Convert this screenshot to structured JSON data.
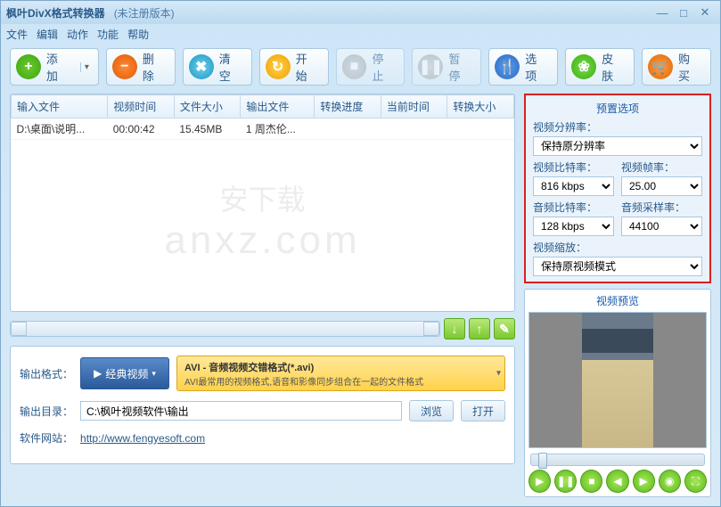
{
  "titlebar": {
    "title": "枫叶DivX格式转换器",
    "subtitle": "(未注册版本)"
  },
  "menu": {
    "file": "文件",
    "edit": "编辑",
    "action": "动作",
    "function": "功能",
    "help": "帮助"
  },
  "toolbar": {
    "add": "添加",
    "delete": "删除",
    "clear": "清空",
    "start": "开始",
    "stop": "停止",
    "pause": "暂停",
    "options": "选项",
    "skin": "皮肤",
    "buy": "购买"
  },
  "table": {
    "headers": {
      "input": "输入文件",
      "vtime": "视频时间",
      "fsize": "文件大小",
      "output": "输出文件",
      "progress": "转换进度",
      "curtime": "当前时间",
      "convsize": "转换大小"
    },
    "rows": [
      {
        "input": "D:\\桌面\\说明...",
        "vtime": "00:00:42",
        "fsize": "15.45MB",
        "output": "1 周杰伦...",
        "progress": "",
        "curtime": "",
        "convsize": ""
      }
    ]
  },
  "watermark": {
    "text1": "安下载",
    "text2": "anxz.com"
  },
  "output": {
    "format_label": "输出格式：",
    "profile_group": "经典视频",
    "profile_title": "AVI - 音频视频交错格式(*.avi)",
    "profile_desc": "AVI最常用的视频格式,语音和影像同步组合在一起的文件格式",
    "dir_label": "输出目录：",
    "dir_value": "C:\\枫叶视频软件\\输出",
    "browse": "浏览",
    "open": "打开",
    "site_label": "软件网站：",
    "site_url": "http://www.fengyesoft.com"
  },
  "preset": {
    "title": "预置选项",
    "res_label": "视频分辨率：",
    "res_value": "保持原分辨率",
    "vbr_label": "视频比特率：",
    "vbr_value": "816 kbps",
    "fps_label": "视频帧率：",
    "fps_value": "25.00",
    "abr_label": "音频比特率：",
    "abr_value": "128 kbps",
    "asr_label": "音频采样率：",
    "asr_value": "44100",
    "scale_label": "视频缩放：",
    "scale_value": "保持原视频模式"
  },
  "preview": {
    "title": "视频预览"
  }
}
